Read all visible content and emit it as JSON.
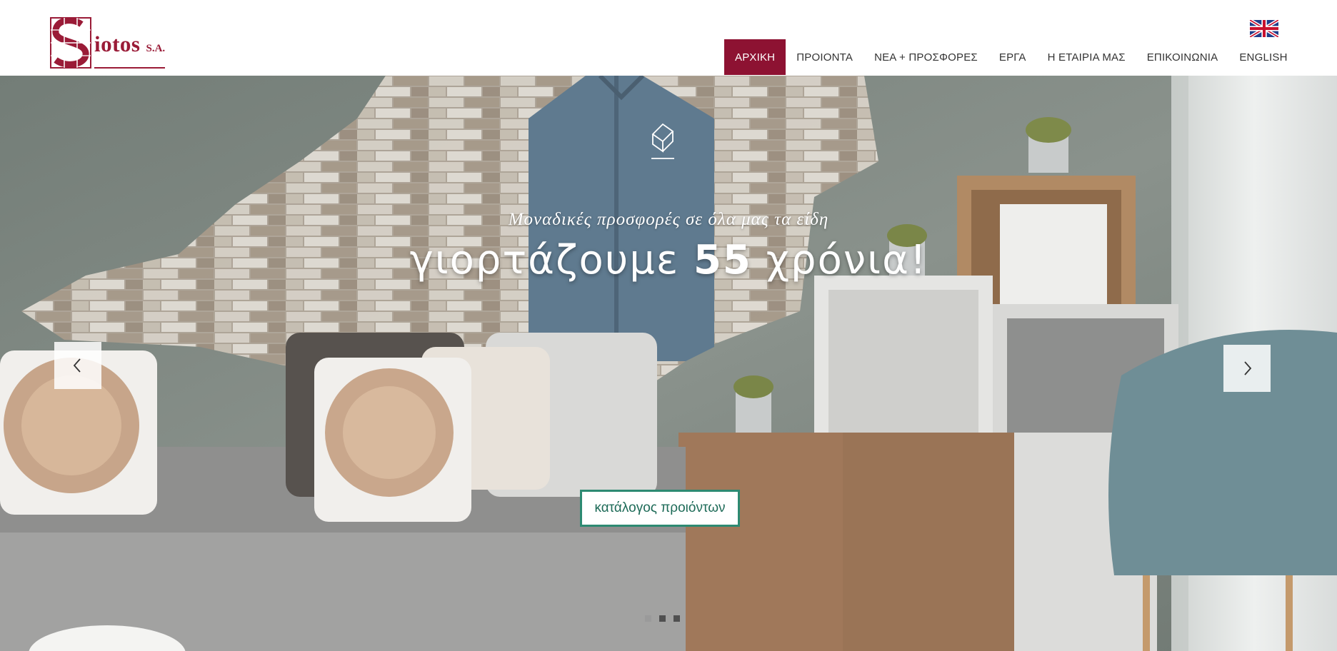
{
  "brand": {
    "name": "iotos",
    "suffix": "S.A.",
    "color": "#9a1b37"
  },
  "header": {
    "language_flag_icon": "uk-flag-icon",
    "nav": [
      {
        "label": "ΑΡΧΙΚΗ",
        "active": true
      },
      {
        "label": "ΠΡΟΙΟΝΤΑ",
        "active": false
      },
      {
        "label": "ΝΕΑ + ΠΡΟΣΦΟΡΕΣ",
        "active": false
      },
      {
        "label": "ΕΡΓΑ",
        "active": false
      },
      {
        "label": "Η ΕΤΑΙΡΙΑ ΜΑΣ",
        "active": false
      },
      {
        "label": "ΕΠΙΚΟΙΝΩΝΙΑ",
        "active": false
      },
      {
        "label": "ENGLISH",
        "active": false
      }
    ],
    "active_color": "#8d1232"
  },
  "hero": {
    "subtitle": "Μοναδικές προσφορές σε όλα μας τα είδη",
    "title_prefix": "γιορτάζουμε",
    "title_number": "55",
    "title_suffix": "χρόνια!",
    "cta_label": "κατάλογος προιόντων",
    "cta_color": "#2d8a72",
    "prev_icon": "chevron-left-icon",
    "next_icon": "chevron-right-icon",
    "slides_total": 3,
    "active_slide": 2
  }
}
